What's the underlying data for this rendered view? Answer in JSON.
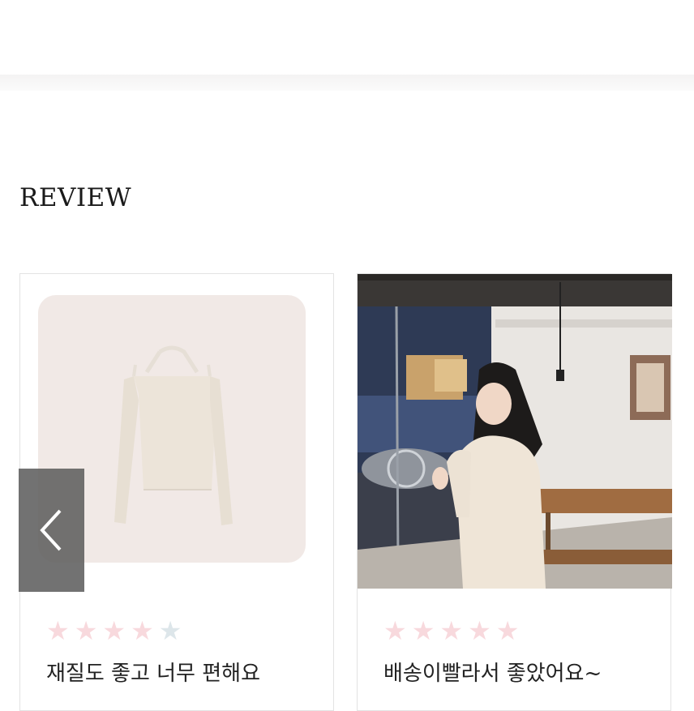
{
  "section": {
    "title": "REVIEW"
  },
  "reviews": [
    {
      "image": "product-sweater-photo",
      "rating": 4,
      "max_rating": 5,
      "text": "재질도 좋고 너무 편해요"
    },
    {
      "image": "customer-photo",
      "rating": 5,
      "max_rating": 5,
      "text": "배송이빨라서 좋았어요~"
    }
  ],
  "icons": {
    "prev": "chevron-left-icon",
    "star": "star-icon"
  },
  "colors": {
    "star_filled": "#f8d9dd",
    "star_empty": "#dde6ea",
    "arrow_bg": "#5f5f5f"
  }
}
